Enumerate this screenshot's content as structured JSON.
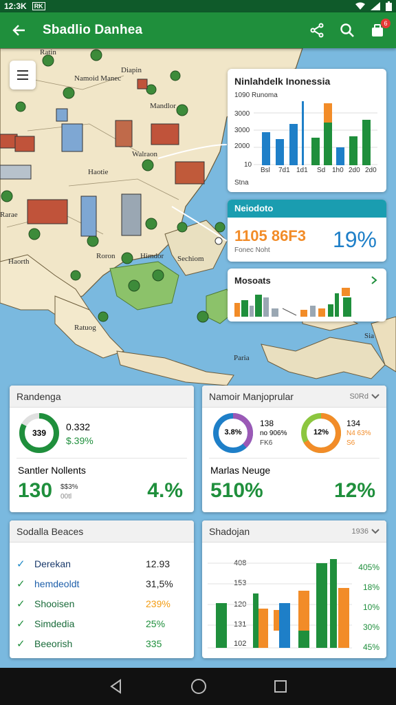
{
  "status": {
    "time": "12:3K",
    "sb_icon": "RK"
  },
  "appbar": {
    "title": "Sbadlio Danhea",
    "badge": "6"
  },
  "map": {
    "labels": [
      "Ratin",
      "Diapin",
      "Namoid Manec",
      "Mandlor",
      "Walraon",
      "Haotie",
      "Roron",
      "Himdor",
      "Sechiom",
      "Haorth",
      "Sia",
      "Ratuog",
      "Rarae",
      "Paria"
    ]
  },
  "region_card": {
    "title": "Ninlahdelk Inonessia",
    "legend_label": "1090 Runoma",
    "yticks": [
      "3000",
      "3000",
      "2000",
      "10"
    ],
    "xlabels": [
      "Bsl",
      "7d1",
      "1d1",
      "Sd",
      "1h0",
      "2d0",
      "2d0"
    ],
    "footer": "Stna"
  },
  "stats_card": {
    "header": "Neiodoto",
    "value": "1105 86F3",
    "sublabel": "Fonec Noht",
    "percent": "19%"
  },
  "markets_card": {
    "title": "Mosoats"
  },
  "panel_left": {
    "header": "Randenga",
    "ring_value": "339",
    "figure1": "0.332",
    "figure2": "$.39%",
    "subheader": "Santler Nollents",
    "big1": "130",
    "small1": "$$3%",
    "small2": "00tl",
    "big2": "4.%"
  },
  "panel_right": {
    "header": "Namoir Manjoprular",
    "header_right": "S0Rd",
    "ring1_value": "3.8%",
    "r1_top": "138",
    "r1_mid": "no 906%",
    "r1_bot": "FK6",
    "ring2_value": "12%",
    "r2_top": "134",
    "r2_mid": "N4 63%",
    "r2_bot": "S6",
    "subheader": "Marlas Neuge",
    "big1": "510%",
    "big2": "12%"
  },
  "list_panel": {
    "header": "Sodalla Beaces",
    "items": [
      {
        "name": "Derekan",
        "value": "12.93",
        "color": "#222"
      },
      {
        "name": "hemdeoldt",
        "value": "31,5%",
        "color": "#222"
      },
      {
        "name": "Shooisen",
        "value": "239%",
        "color": "#f39c12"
      },
      {
        "name": "Simdedia",
        "value": "25%",
        "color": "#1f8f3c"
      },
      {
        "name": "Beeorish",
        "value": "335",
        "color": "#1f8f3c"
      }
    ]
  },
  "chart_panel": {
    "header": "Shadojan",
    "header_right": "1936",
    "yticks": [
      "408",
      "153",
      "120",
      "131",
      "102"
    ],
    "right_labels": [
      "405%",
      "18%",
      "10%",
      "30%",
      "45%"
    ]
  },
  "colors": {
    "green": "#1f8f3c",
    "blue": "#1e7fc8",
    "orange": "#f28c28",
    "teal": "#1a9db0"
  }
}
